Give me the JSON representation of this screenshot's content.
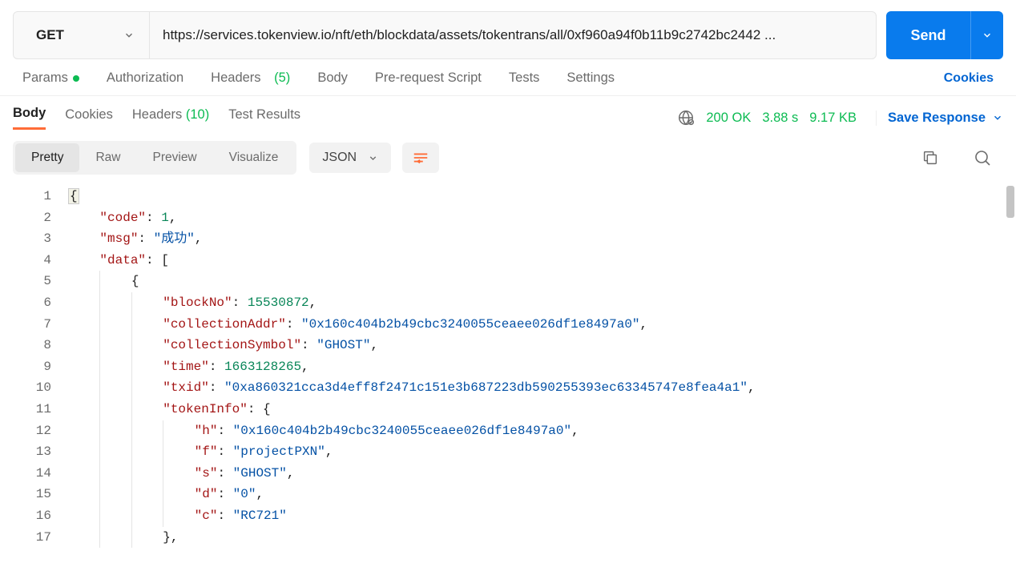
{
  "request": {
    "method": "GET",
    "url": "https://services.tokenview.io/nft/eth/blockdata/assets/tokentrans/all/0xf960a94f0b11b9c2742bc2442 ...",
    "send_label": "Send"
  },
  "req_tabs": {
    "params": "Params",
    "authorization": "Authorization",
    "headers_label": "Headers",
    "headers_count": "(5)",
    "body": "Body",
    "prerequest": "Pre-request Script",
    "tests": "Tests",
    "settings": "Settings",
    "cookies": "Cookies"
  },
  "resp_tabs": {
    "body": "Body",
    "cookies": "Cookies",
    "headers_label": "Headers",
    "headers_count": "(10)",
    "test_results": "Test Results"
  },
  "status": {
    "code": "200 OK",
    "time": "3.88 s",
    "size": "9.17 KB",
    "save": "Save Response"
  },
  "view_modes": {
    "pretty": "Pretty",
    "raw": "Raw",
    "preview": "Preview",
    "visualize": "Visualize",
    "format": "JSON"
  },
  "response_json": {
    "code": 1,
    "msg": "成功",
    "data": [
      {
        "blockNo": 15530872,
        "collectionAddr": "0x160c404b2b49cbc3240055ceaee026df1e8497a0",
        "collectionSymbol": "GHOST",
        "time": 1663128265,
        "txid": "0xa860321cca3d4eff8f2471c151e3b687223db590255393ec63345747e8fea4a1",
        "tokenInfo": {
          "h": "0x160c404b2b49cbc3240055ceaee026df1e8497a0",
          "f": "projectPXN",
          "s": "GHOST",
          "d": "0",
          "c": "RC721"
        }
      }
    ]
  },
  "line_numbers": [
    "1",
    "2",
    "3",
    "4",
    "5",
    "6",
    "7",
    "8",
    "9",
    "10",
    "11",
    "12",
    "13",
    "14",
    "15",
    "16",
    "17"
  ]
}
